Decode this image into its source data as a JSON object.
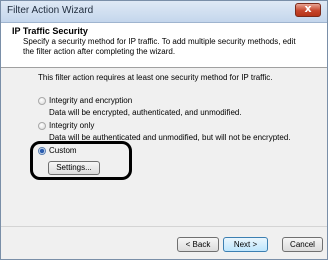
{
  "window": {
    "title": "Filter Action Wizard",
    "close_symbol": "x"
  },
  "header": {
    "title": "IP Traffic Security",
    "description": "Specify a security method for IP traffic. To add multiple security methods, edit the filter action after completing the wizard."
  },
  "content": {
    "intro": "This filter action requires at least one security method for IP traffic.",
    "options": [
      {
        "label": "Integrity and encryption",
        "description": "Data will be encrypted, authenticated, and unmodified.",
        "selected": false
      },
      {
        "label": "Integrity only",
        "description": "Data will be authenticated and unmodified, but will not be encrypted.",
        "selected": false
      },
      {
        "label": "Custom",
        "selected": true
      }
    ],
    "settings_button": "Settings..."
  },
  "footer": {
    "back_button": "< Back",
    "next_button": "Next >",
    "cancel_button": "Cancel"
  },
  "colors": {
    "highlight_ring": "#000000",
    "title_bar": "#c4d6ec",
    "close_button": "#c6452c"
  }
}
